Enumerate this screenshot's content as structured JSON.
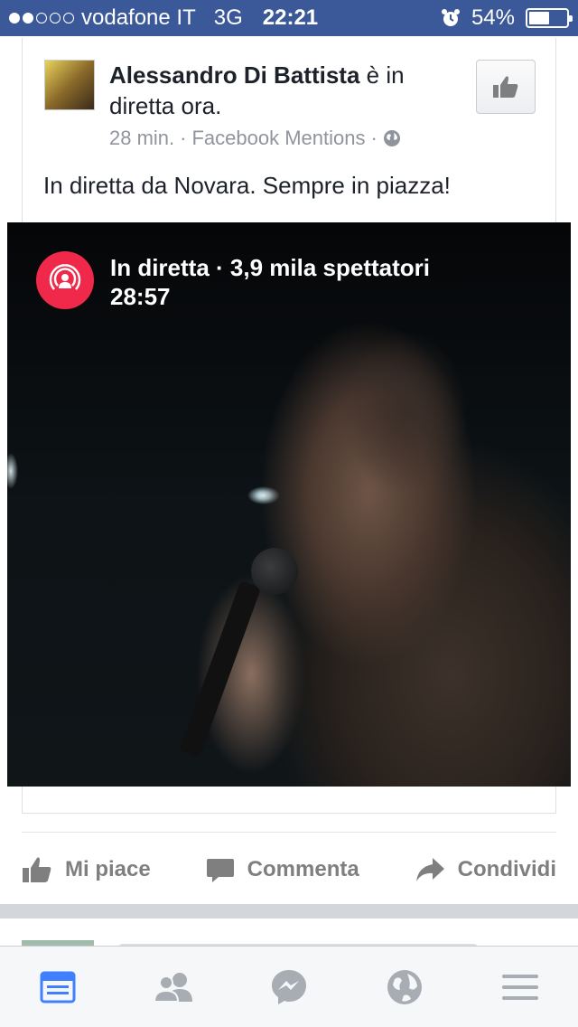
{
  "status_bar": {
    "carrier": "vodafone IT",
    "network": "3G",
    "time": "22:21",
    "battery": "54%",
    "battery_level": 0.54,
    "signal_bars_filled": 2,
    "signal_bars_total": 5
  },
  "post": {
    "author": "Alessandro Di Battista",
    "status_suffix": " è in diretta ora.",
    "time_ago": "28 min.",
    "separator": "·",
    "source": "Facebook Mentions",
    "text": "In diretta da Novara. Sempre in piazza!"
  },
  "video": {
    "live_label": "In diretta · 3,9 mila spettatori",
    "duration": "28:57"
  },
  "actions": {
    "like": "Mi piace",
    "comment": "Commenta",
    "share": "Condividi"
  },
  "colors": {
    "brand": "#3b5998",
    "live_red": "#f0284a",
    "tab_active": "#4080ff",
    "tab_inactive": "#a8acb3"
  },
  "tabs": [
    {
      "name": "news-feed-icon",
      "active": true
    },
    {
      "name": "friends-icon",
      "active": false
    },
    {
      "name": "messenger-icon",
      "active": false
    },
    {
      "name": "globe-icon",
      "active": false
    },
    {
      "name": "menu-icon",
      "active": false
    }
  ]
}
